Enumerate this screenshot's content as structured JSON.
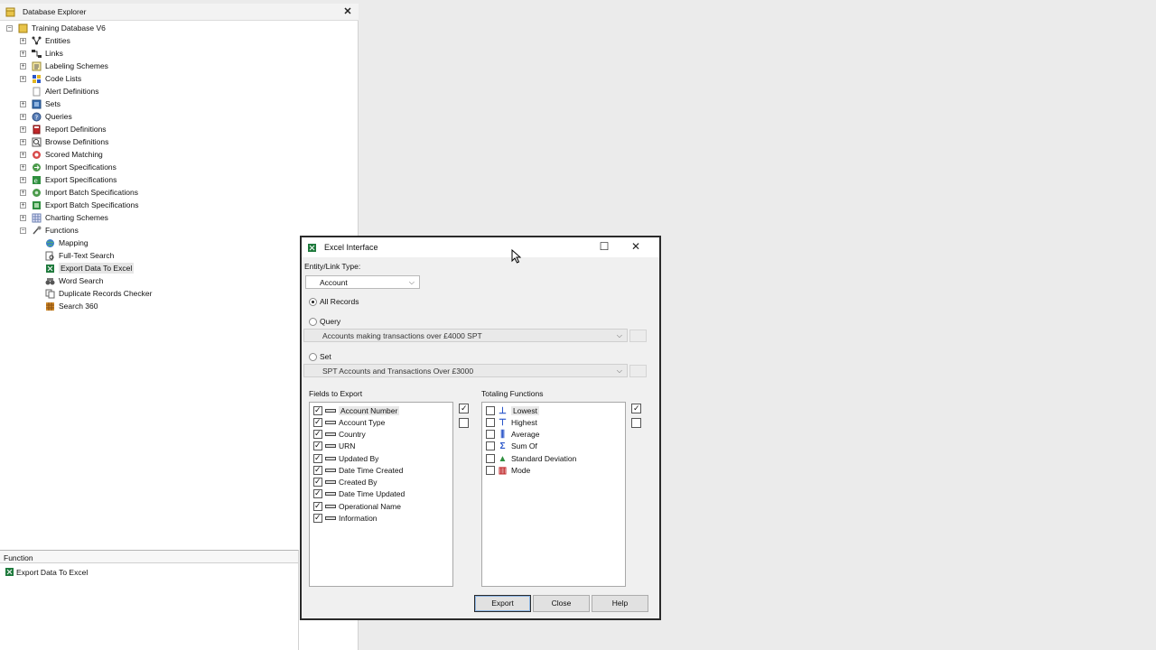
{
  "explorer": {
    "title": "Database Explorer",
    "root": "Training Database V6",
    "items": [
      {
        "label": "Entities",
        "icon": "entities-icon"
      },
      {
        "label": "Links",
        "icon": "links-icon"
      },
      {
        "label": "Labeling Schemes",
        "icon": "labeling-schemes-icon"
      },
      {
        "label": "Code Lists",
        "icon": "code-lists-icon"
      },
      {
        "label": "Alert Definitions",
        "icon": "alert-definitions-icon"
      },
      {
        "label": "Sets",
        "icon": "sets-icon"
      },
      {
        "label": "Queries",
        "icon": "queries-icon"
      },
      {
        "label": "Report Definitions",
        "icon": "report-definitions-icon"
      },
      {
        "label": "Browse Definitions",
        "icon": "browse-definitions-icon"
      },
      {
        "label": "Scored Matching",
        "icon": "scored-matching-icon"
      },
      {
        "label": "Import Specifications",
        "icon": "import-specifications-icon"
      },
      {
        "label": "Export Specifications",
        "icon": "export-specifications-icon"
      },
      {
        "label": "Import Batch Specifications",
        "icon": "import-batch-icon"
      },
      {
        "label": "Export Batch Specifications",
        "icon": "export-batch-icon"
      },
      {
        "label": "Charting Schemes",
        "icon": "charting-schemes-icon"
      },
      {
        "label": "Functions",
        "icon": "functions-icon"
      }
    ],
    "functions": [
      {
        "label": "Mapping",
        "icon": "globe-icon"
      },
      {
        "label": "Full-Text Search",
        "icon": "full-text-search-icon"
      },
      {
        "label": "Export Data To Excel",
        "icon": "excel-export-icon",
        "selected": true
      },
      {
        "label": "Word Search",
        "icon": "binoculars-icon"
      },
      {
        "label": "Duplicate Records Checker",
        "icon": "duplicate-checker-icon"
      },
      {
        "label": "Search 360",
        "icon": "search-360-icon"
      }
    ]
  },
  "function_pane": {
    "header": "Function",
    "item": "Export Data To Excel"
  },
  "dialog": {
    "title": "Excel Interface",
    "entity_label": "Entity/Link Type:",
    "entity_value": "Account",
    "all_records": "All Records",
    "query_label": "Query",
    "query_value": "Accounts making transactions over £4000 SPT",
    "set_label": "Set",
    "set_value": "SPT Accounts and Transactions Over £3000",
    "fields_label": "Fields to Export",
    "fields": [
      "Account Number",
      "Account Type",
      "Country",
      "URN",
      "Updated By",
      "Date Time Created",
      "Created By",
      "Date Time Updated",
      "Operational Name",
      "Information"
    ],
    "totaling_label": "Totaling Functions",
    "totaling": [
      {
        "label": "Lowest",
        "icon": "lowest-icon"
      },
      {
        "label": "Highest",
        "icon": "highest-icon"
      },
      {
        "label": "Average",
        "icon": "average-icon"
      },
      {
        "label": "Sum Of",
        "icon": "sigma-icon"
      },
      {
        "label": "Standard Deviation",
        "icon": "std-deviation-icon"
      },
      {
        "label": "Mode",
        "icon": "mode-icon"
      }
    ],
    "buttons": {
      "export": "Export",
      "close": "Close",
      "help": "Help"
    }
  },
  "colors": {
    "excel_green": "#1e7a3c",
    "selection": "#e6e6e6",
    "dialog_border": "#2a2a2a"
  }
}
